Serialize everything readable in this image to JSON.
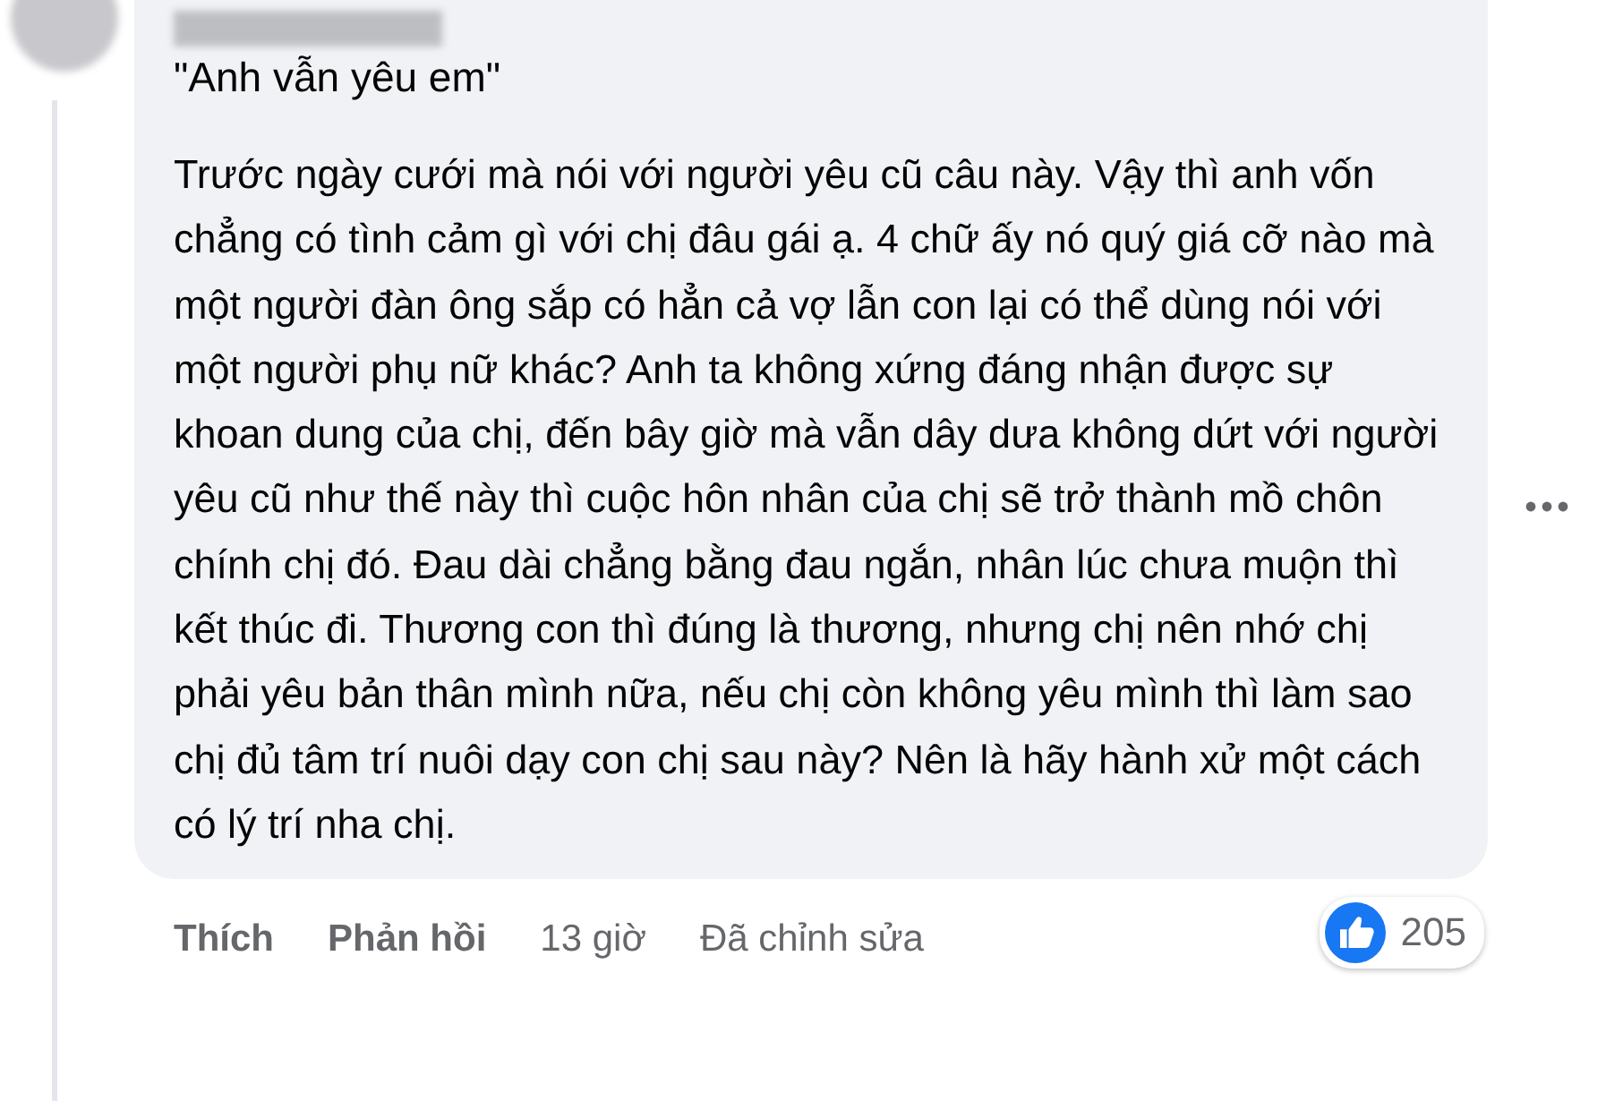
{
  "comment": {
    "quote": "\"Anh vẫn yêu em\"",
    "body": "Trước ngày cưới mà nói với người yêu cũ câu này. Vậy thì anh vốn chẳng có tình cảm gì với chị đâu gái ạ. 4 chữ ấy nó quý giá cỡ nào mà một người đàn ông sắp có hẳn cả vợ lẫn con lại có thể dùng nói với một người phụ nữ khác? Anh ta không xứng đáng nhận được sự khoan dung của chị, đến bây giờ mà vẫn dây dưa không dứt với người yêu cũ như thế này thì cuộc hôn nhân của chị sẽ trở thành mồ chôn chính chị đó. Đau dài chẳng bằng đau ngắn, nhân lúc chưa muộn thì kết thúc đi. Thương con thì đúng là thương, nhưng chị nên nhớ chị phải yêu bản thân mình nữa, nếu chị còn không yêu mình thì làm sao chị đủ tâm trí nuôi dạy con chị sau này? Nên là hãy hành xử một cách có lý trí nha chị.",
    "reaction_count": "205",
    "actions": [
      {
        "kind": "link",
        "label": "Thích"
      },
      {
        "kind": "link",
        "label": "Phản hồi"
      },
      {
        "kind": "meta",
        "label": "13 giờ"
      },
      {
        "kind": "meta",
        "label": "Đã chỉnh sửa"
      }
    ]
  }
}
